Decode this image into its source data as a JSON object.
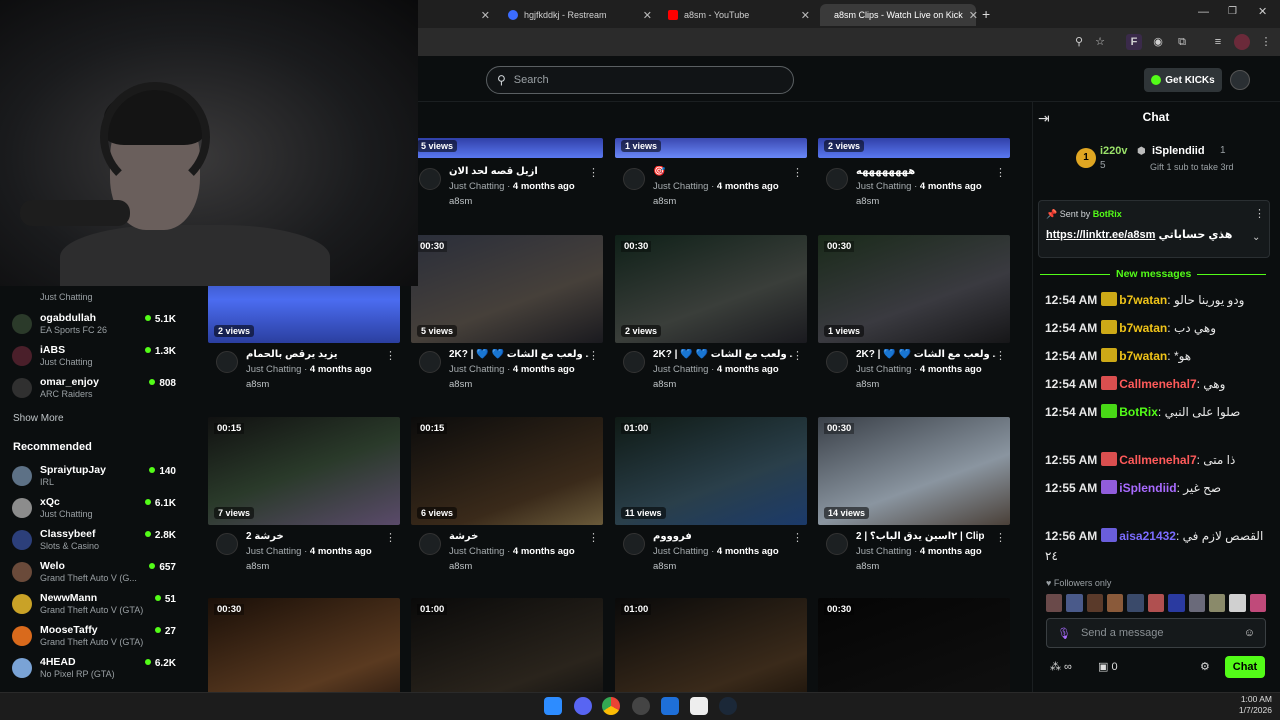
{
  "browser": {
    "tabs": [
      {
        "label": "hgjfkddkj - Restream"
      },
      {
        "label": "a8sm - YouTube"
      },
      {
        "label": "a8sm Clips - Watch Live on Kick"
      }
    ],
    "new_tab_label": "+"
  },
  "header": {
    "search_placeholder": "Search",
    "get_kicks_label": "Get KICKs"
  },
  "sidebar": {
    "following": [
      {
        "name": "ogabdullah",
        "category": "EA Sports FC 26",
        "count": "5.1K",
        "color": "#2b3a2a"
      },
      {
        "name": "iABS",
        "category": "Just Chatting",
        "count": "1.3K",
        "color": "#4a1f2a"
      },
      {
        "name": "omar_enjoy",
        "category": "ARC Raiders",
        "count": "808",
        "color": "#303030"
      }
    ],
    "partial_item": {
      "category": "Just Chatting"
    },
    "show_more": "Show More",
    "recommended_title": "Recommended",
    "recommended": [
      {
        "name": "SpraiytupJay",
        "category": "IRL",
        "count": "140",
        "color": "#5d7186"
      },
      {
        "name": "xQc",
        "category": "Just Chatting",
        "count": "6.1K",
        "color": "#8c8c8c"
      },
      {
        "name": "Classybeef",
        "category": "Slots & Casino",
        "count": "2.8K",
        "color": "#2c3f7a"
      },
      {
        "name": "Welo",
        "category": "Grand Theft Auto V (G...",
        "count": "657",
        "color": "#6a4a3a"
      },
      {
        "name": "NewwMann",
        "category": "Grand Theft Auto V (GTA)",
        "count": "51",
        "color": "#c9a227"
      },
      {
        "name": "MooseTaffy",
        "category": "Grand Theft Auto V (GTA)",
        "count": "27",
        "color": "#d96a1c"
      },
      {
        "name": "4HEAD",
        "category": "No Pixel RP (GTA)",
        "count": "6.2K",
        "color": "#7aa3d6"
      }
    ]
  },
  "clips_row1": [
    {
      "views": "5 views",
      "title": "ازيل قصه لحد الان",
      "category": "Just Chatting",
      "age": "4 months ago",
      "channel": "a8sm"
    },
    {
      "views": "1 views",
      "title": "🎯",
      "category": "Just Chatting",
      "age": "4 months ago",
      "channel": "a8sm"
    },
    {
      "views": "2 views",
      "title": "ههههههههه",
      "category": "Just Chatting",
      "age": "4 months ago",
      "channel": "a8sm"
    }
  ],
  "clips_row2": [
    {
      "duration": "",
      "views": "2 views",
      "title": "يزيد يرقص بالحمام",
      "category": "Just Chatting",
      "age": "4 months ago",
      "channel": "a8sm"
    },
    {
      "duration": "00:30",
      "views": "5 views",
      "title": "2K? | 💙 💙 ولعب مع الشات ...",
      "category": "Just Chatting",
      "age": "4 months ago",
      "channel": "a8sm"
    },
    {
      "duration": "00:30",
      "views": "2 views",
      "title": "2K? | 💙 💙 ولعب مع الشات ...",
      "category": "Just Chatting",
      "age": "4 months ago",
      "channel": "a8sm"
    },
    {
      "duration": "00:30",
      "views": "1 views",
      "title": "2K? | 💙 💙 ولعب مع الشات ...",
      "category": "Just Chatting",
      "age": "4 months ago",
      "channel": "a8sm"
    }
  ],
  "clips_row3": [
    {
      "duration": "00:15",
      "views": "7 views",
      "title": "خرشة 2",
      "category": "Just Chatting",
      "age": "4 months ago",
      "channel": "a8sm"
    },
    {
      "duration": "00:15",
      "views": "6 views",
      "title": "خرشة",
      "category": "Just Chatting",
      "age": "4 months ago",
      "channel": "a8sm"
    },
    {
      "duration": "01:00",
      "views": "11 views",
      "title": "فروووم",
      "category": "Just Chatting",
      "age": "4 months ago",
      "channel": "a8sm"
    },
    {
      "duration": "00:30",
      "views": "14 views",
      "title": "2 | ٢اسين يدق الباب؟ | Clip",
      "category": "Just Chatting",
      "age": "4 months ago",
      "channel": "a8sm"
    }
  ],
  "clips_row4": [
    {
      "duration": "00:30"
    },
    {
      "duration": "01:00"
    },
    {
      "duration": "01:00"
    },
    {
      "duration": "00:30"
    }
  ],
  "chat": {
    "title": "Chat",
    "gifter": {
      "rank": "1",
      "name": "i220v",
      "amount": "5"
    },
    "top_sub": {
      "name": "iSplendiid",
      "amount": "1",
      "subtitle": "Gift 1 sub to take 3rd"
    },
    "pinned": {
      "sent_by_label": "Sent by",
      "sender": "BotRix",
      "link": "https://linktr.ee/a8sm",
      "text": "هذي حساباتي"
    },
    "new_messages_label": "New messages",
    "messages": [
      {
        "time": "12:54 AM",
        "user": "b7watan",
        "user_color": "#f0c419",
        "text": "ودو يورينا حالو"
      },
      {
        "time": "12:54 AM",
        "user": "b7watan",
        "user_color": "#f0c419",
        "text": "وهي دب"
      },
      {
        "time": "12:54 AM",
        "user": "b7watan",
        "user_color": "#f0c419",
        "text": "*هو"
      },
      {
        "time": "12:54 AM",
        "user": "Callmenehal7",
        "user_color": "#ff5a5a",
        "text": "وهي"
      },
      {
        "time": "12:54 AM",
        "user": "BotRix",
        "user_color": "#53fc18",
        "text": "صلوا على النبي"
      },
      {
        "time": "12:55 AM",
        "user": "Callmenehal7",
        "user_color": "#ff5a5a",
        "text": "ذا متى"
      },
      {
        "time": "12:55 AM",
        "user": "iSplendiid",
        "user_color": "#a96bff",
        "text": "صح غير"
      },
      {
        "time": "12:56 AM",
        "user": "aisa21432",
        "user_color": "#7b6cff",
        "text": "القصص لازم في ٢٤"
      }
    ],
    "followers_only": "Followers only",
    "send_placeholder": "Send a message",
    "points": "0",
    "send_label": "Chat"
  },
  "taskbar": {
    "time": "1:00 AM",
    "date": "1/7/2026"
  }
}
